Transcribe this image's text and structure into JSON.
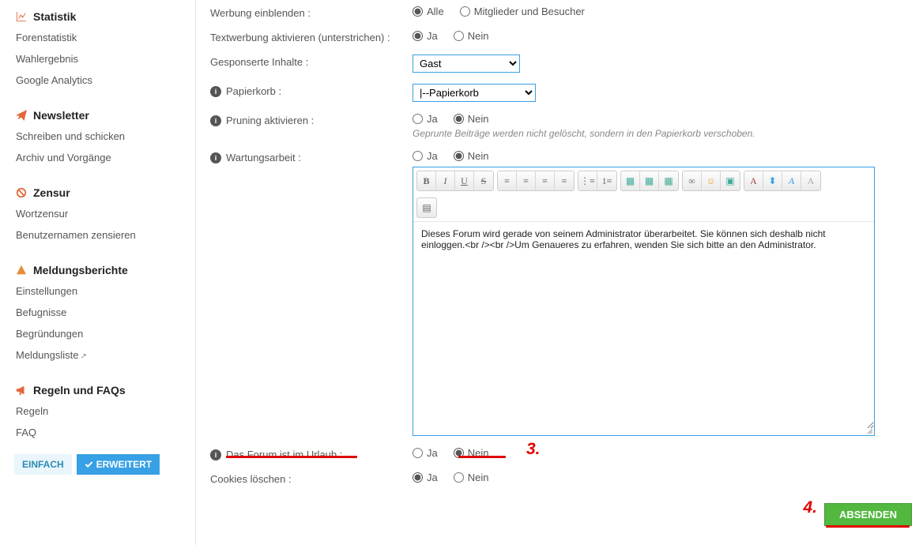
{
  "sidebar": {
    "statistik": {
      "title": "Statistik",
      "items": [
        "Forenstatistik",
        "Wahlergebnis",
        "Google Analytics"
      ]
    },
    "newsletter": {
      "title": "Newsletter",
      "items": [
        "Schreiben und schicken",
        "Archiv und Vorgänge"
      ]
    },
    "zensur": {
      "title": "Zensur",
      "items": [
        "Wortzensur",
        "Benutzernamen zensieren"
      ]
    },
    "meldungen": {
      "title": "Meldungsberichte",
      "items": [
        "Einstellungen",
        "Befugnisse",
        "Begründungen",
        "Meldungsliste"
      ]
    },
    "regeln": {
      "title": "Regeln und FAQs",
      "items": [
        "Regeln",
        "FAQ"
      ]
    },
    "btn_simple": "EINFACH",
    "btn_ext": "ERWEITERT"
  },
  "form": {
    "werbung": {
      "label": "Werbung einblenden :",
      "opt_alle": "Alle",
      "opt_mb": "Mitglieder und Besucher"
    },
    "textwerbung": {
      "label": "Textwerbung aktivieren (unterstrichen) :",
      "opt_ja": "Ja",
      "opt_nein": "Nein"
    },
    "gesponsert": {
      "label": "Gesponserte Inhalte :",
      "value": "Gast"
    },
    "papierkorb": {
      "label": "Papierkorb :",
      "value": "|--Papierkorb"
    },
    "pruning": {
      "label": "Pruning aktivieren :",
      "opt_ja": "Ja",
      "opt_nein": "Nein",
      "hint": "Geprunte Beiträge werden nicht gelöscht, sondern in den Papierkorb verschoben."
    },
    "wartung": {
      "label": "Wartungsarbeit :",
      "opt_ja": "Ja",
      "opt_nein": "Nein",
      "text": "Dieses Forum wird gerade von seinem Administrator überarbeitet. Sie können sich deshalb nicht einloggen.<br /><br />Um Genaueres zu erfahren, wenden Sie sich bitte an den Administrator."
    },
    "urlaub": {
      "label": "Das Forum ist im Urlaub :",
      "opt_ja": "Ja",
      "opt_nein": "Nein"
    },
    "cookies": {
      "label": "Cookies löschen :",
      "opt_ja": "Ja",
      "opt_nein": "Nein"
    },
    "submit": "ABSENDEN"
  },
  "annotations": {
    "n3": "3.",
    "n4": "4."
  }
}
